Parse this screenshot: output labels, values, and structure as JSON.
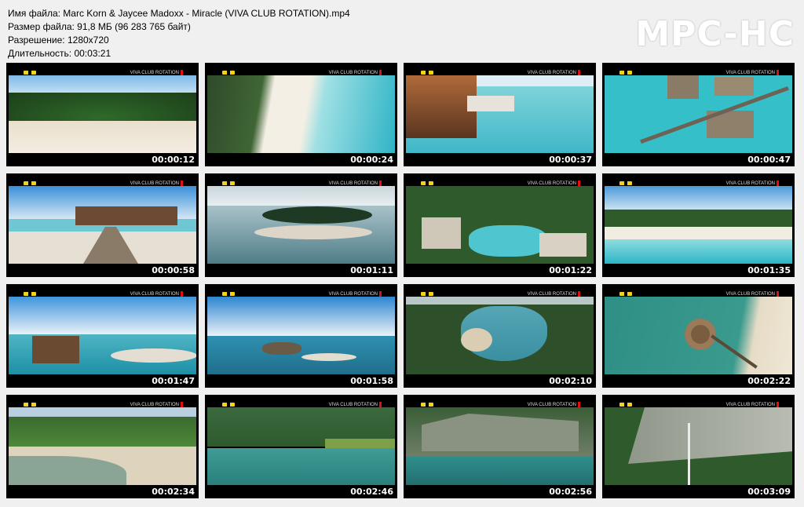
{
  "info": {
    "file_name": "Имя файла: Marc Korn & Jaycee Madoxx - Miracle (VIVA CLUB ROTATION).mp4",
    "file_size": "Размер файла: 91,8 МБ (96 283 765 байт)",
    "resolution": "Разрешение: 1280x720",
    "duration": "Длительность: 00:03:21"
  },
  "logo": "MPC-HC",
  "channel_label": "VIVA CLUB ROTATION",
  "colors": {
    "background": "#f0f0f0",
    "viva_yellow": "#f3d21a",
    "accent_red": "#e01010"
  },
  "thumbnails": [
    {
      "time": "00:00:12"
    },
    {
      "time": "00:00:24"
    },
    {
      "time": "00:00:37"
    },
    {
      "time": "00:00:47"
    },
    {
      "time": "00:00:58"
    },
    {
      "time": "00:01:11"
    },
    {
      "time": "00:01:22"
    },
    {
      "time": "00:01:35"
    },
    {
      "time": "00:01:47"
    },
    {
      "time": "00:01:58"
    },
    {
      "time": "00:02:10"
    },
    {
      "time": "00:02:22"
    },
    {
      "time": "00:02:34"
    },
    {
      "time": "00:02:46"
    },
    {
      "time": "00:02:56"
    },
    {
      "time": "00:03:09"
    }
  ]
}
